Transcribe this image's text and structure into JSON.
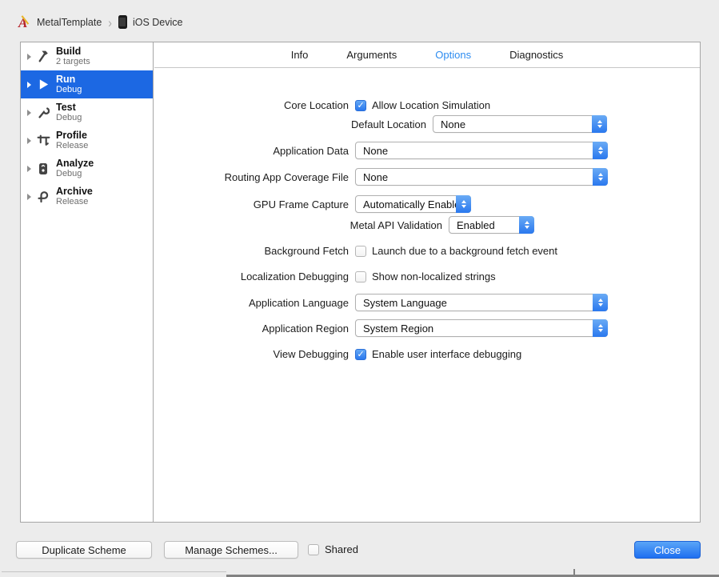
{
  "breadcrumb": {
    "project": "MetalTemplate",
    "separator": "›",
    "destination": "iOS Device"
  },
  "sidebar": {
    "items": [
      {
        "title": "Build",
        "subtitle": "2 targets",
        "icon": "hammer-icon",
        "selected": false
      },
      {
        "title": "Run",
        "subtitle": "Debug",
        "icon": "play-icon",
        "selected": true
      },
      {
        "title": "Test",
        "subtitle": "Debug",
        "icon": "wrench-icon",
        "selected": false
      },
      {
        "title": "Profile",
        "subtitle": "Release",
        "icon": "caliper-icon",
        "selected": false
      },
      {
        "title": "Analyze",
        "subtitle": "Debug",
        "icon": "analyze-icon",
        "selected": false
      },
      {
        "title": "Archive",
        "subtitle": "Release",
        "icon": "archive-icon",
        "selected": false
      }
    ]
  },
  "tabs": [
    {
      "label": "Info",
      "selected": false
    },
    {
      "label": "Arguments",
      "selected": false
    },
    {
      "label": "Options",
      "selected": true
    },
    {
      "label": "Diagnostics",
      "selected": false
    }
  ],
  "form": {
    "rows": [
      {
        "label": "Core Location",
        "type": "checkbox",
        "text": "Allow Location Simulation",
        "checked": true
      },
      {
        "label": "Default Location",
        "type": "popup",
        "value": "None"
      },
      {
        "label": "Application Data",
        "type": "popup",
        "value": "None"
      },
      {
        "label": "Routing App Coverage File",
        "type": "popup",
        "value": "None"
      },
      {
        "label": "GPU Frame Capture",
        "type": "popup",
        "value": "Automatically Enabled"
      },
      {
        "label": "Metal API Validation",
        "type": "popup",
        "value": "Enabled"
      },
      {
        "label": "Background Fetch",
        "type": "checkbox",
        "text": "Launch due to a background fetch event",
        "checked": false
      },
      {
        "label": "Localization Debugging",
        "type": "checkbox",
        "text": "Show non-localized strings",
        "checked": false
      },
      {
        "label": "Application Language",
        "type": "popup",
        "value": "System Language"
      },
      {
        "label": "Application Region",
        "type": "popup",
        "value": "System Region"
      },
      {
        "label": "View Debugging",
        "type": "checkbox",
        "text": "Enable user interface debugging",
        "checked": true
      }
    ]
  },
  "footer": {
    "duplicate_label": "Duplicate Scheme",
    "manage_label": "Manage Schemes...",
    "shared_label": "Shared",
    "shared_checked": false,
    "close_label": "Close"
  },
  "colors": {
    "accent_blue": "#2a78ee",
    "tab_selected": "#2d8cf0",
    "sidebar_selected": "#1c68e3",
    "panel_border": "#a6a6a6",
    "background": "#ececec"
  }
}
